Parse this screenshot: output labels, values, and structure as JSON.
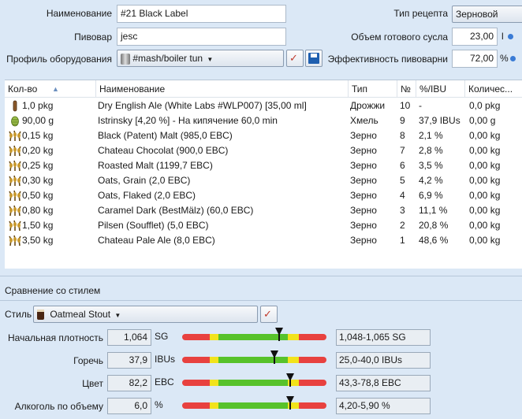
{
  "recipe": {
    "name_label": "Наименование",
    "name_value": "#21 Black Label",
    "brewer_label": "Пивовар",
    "brewer_value": "jesc",
    "equipment_label": "Профиль оборудования",
    "equipment_value": "#mash/boiler tun",
    "type_label": "Тип рецепта",
    "type_value": "Зерновой",
    "volume_label": "Объем готового сусла",
    "volume_value": "23,00",
    "volume_unit": "l",
    "efficiency_label": "Эффективность пивоварни",
    "efficiency_value": "72,00",
    "efficiency_unit": "%"
  },
  "table": {
    "columns": [
      "Кол-во",
      "Наименование",
      "Тип",
      "№",
      "%/IBU",
      "Количес..."
    ],
    "rows": [
      {
        "icon": "yeast-vial-icon",
        "qty": "1,0 pkg",
        "name": "Dry English Ale (White Labs #WLP007) [35,00 ml]",
        "type": "Дрожжи",
        "num": "10",
        "pct": "-",
        "amount": "0,0 pkg"
      },
      {
        "icon": "hop-cone-icon",
        "qty": "90,00 g",
        "name": "Istrinsky [4,20 %] - На кипячение 60,0 min",
        "type": "Хмель",
        "num": "9",
        "pct": "37,9 IBUs",
        "amount": "0,00 g"
      },
      {
        "icon": "grain-sack-icon",
        "qty": "0,15 kg",
        "name": "Black (Patent) Malt (985,0 EBC)",
        "type": "Зерно",
        "num": "8",
        "pct": "2,1 %",
        "amount": "0,00 kg"
      },
      {
        "icon": "grain-sack-icon",
        "qty": "0,20 kg",
        "name": "Chateau Chocolat (900,0 EBC)",
        "type": "Зерно",
        "num": "7",
        "pct": "2,8 %",
        "amount": "0,00 kg"
      },
      {
        "icon": "grain-sack-icon",
        "qty": "0,25 kg",
        "name": "Roasted Malt (1199,7 EBC)",
        "type": "Зерно",
        "num": "6",
        "pct": "3,5 %",
        "amount": "0,00 kg"
      },
      {
        "icon": "grain-sack-icon",
        "qty": "0,30 kg",
        "name": "Oats, Grain (2,0 EBC)",
        "type": "Зерно",
        "num": "5",
        "pct": "4,2 %",
        "amount": "0,00 kg"
      },
      {
        "icon": "grain-sack-icon",
        "qty": "0,50 kg",
        "name": "Oats, Flaked (2,0 EBC)",
        "type": "Зерно",
        "num": "4",
        "pct": "6,9 %",
        "amount": "0,00 kg"
      },
      {
        "icon": "grain-sack-icon",
        "qty": "0,80 kg",
        "name": "Caramel Dark (BestMälz) (60,0 EBC)",
        "type": "Зерно",
        "num": "3",
        "pct": "11,1 %",
        "amount": "0,00 kg"
      },
      {
        "icon": "grain-sack-icon",
        "qty": "1,50 kg",
        "name": "Pilsen (Soufflet) (5,0 EBC)",
        "type": "Зерно",
        "num": "2",
        "pct": "20,8 %",
        "amount": "0,00 kg"
      },
      {
        "icon": "grain-sack-icon",
        "qty": "3,50 kg",
        "name": "Chateau Pale Ale (8,0 EBC)",
        "type": "Зерно",
        "num": "1",
        "pct": "48,6 %",
        "amount": "0,00 kg"
      }
    ]
  },
  "style_section": {
    "title": "Сравнение со стилем",
    "style_label": "Стиль",
    "style_value": "Oatmeal Stout",
    "metrics": [
      {
        "label": "Начальная плотность",
        "value": "1,064",
        "unit": "SG",
        "range": "1,048-1,065 SG",
        "marker_fraction": 0.67
      },
      {
        "label": "Горечь",
        "value": "37,9",
        "unit": "IBUs",
        "range": "25,0-40,0 IBUs",
        "marker_fraction": 0.64
      },
      {
        "label": "Цвет",
        "value": "82,2",
        "unit": "EBC",
        "range": "43,3-78,8 EBC",
        "marker_fraction": 0.75
      },
      {
        "label": "Алкоголь по объему",
        "value": "6,0",
        "unit": "%",
        "range": "4,20-5,90 %",
        "marker_fraction": 0.75
      }
    ]
  },
  "colors": {
    "accent_dot": "#3a7bd5",
    "bar_red": "#e8413f",
    "bar_yellow": "#f2e31b",
    "bar_green": "#57c22b"
  }
}
